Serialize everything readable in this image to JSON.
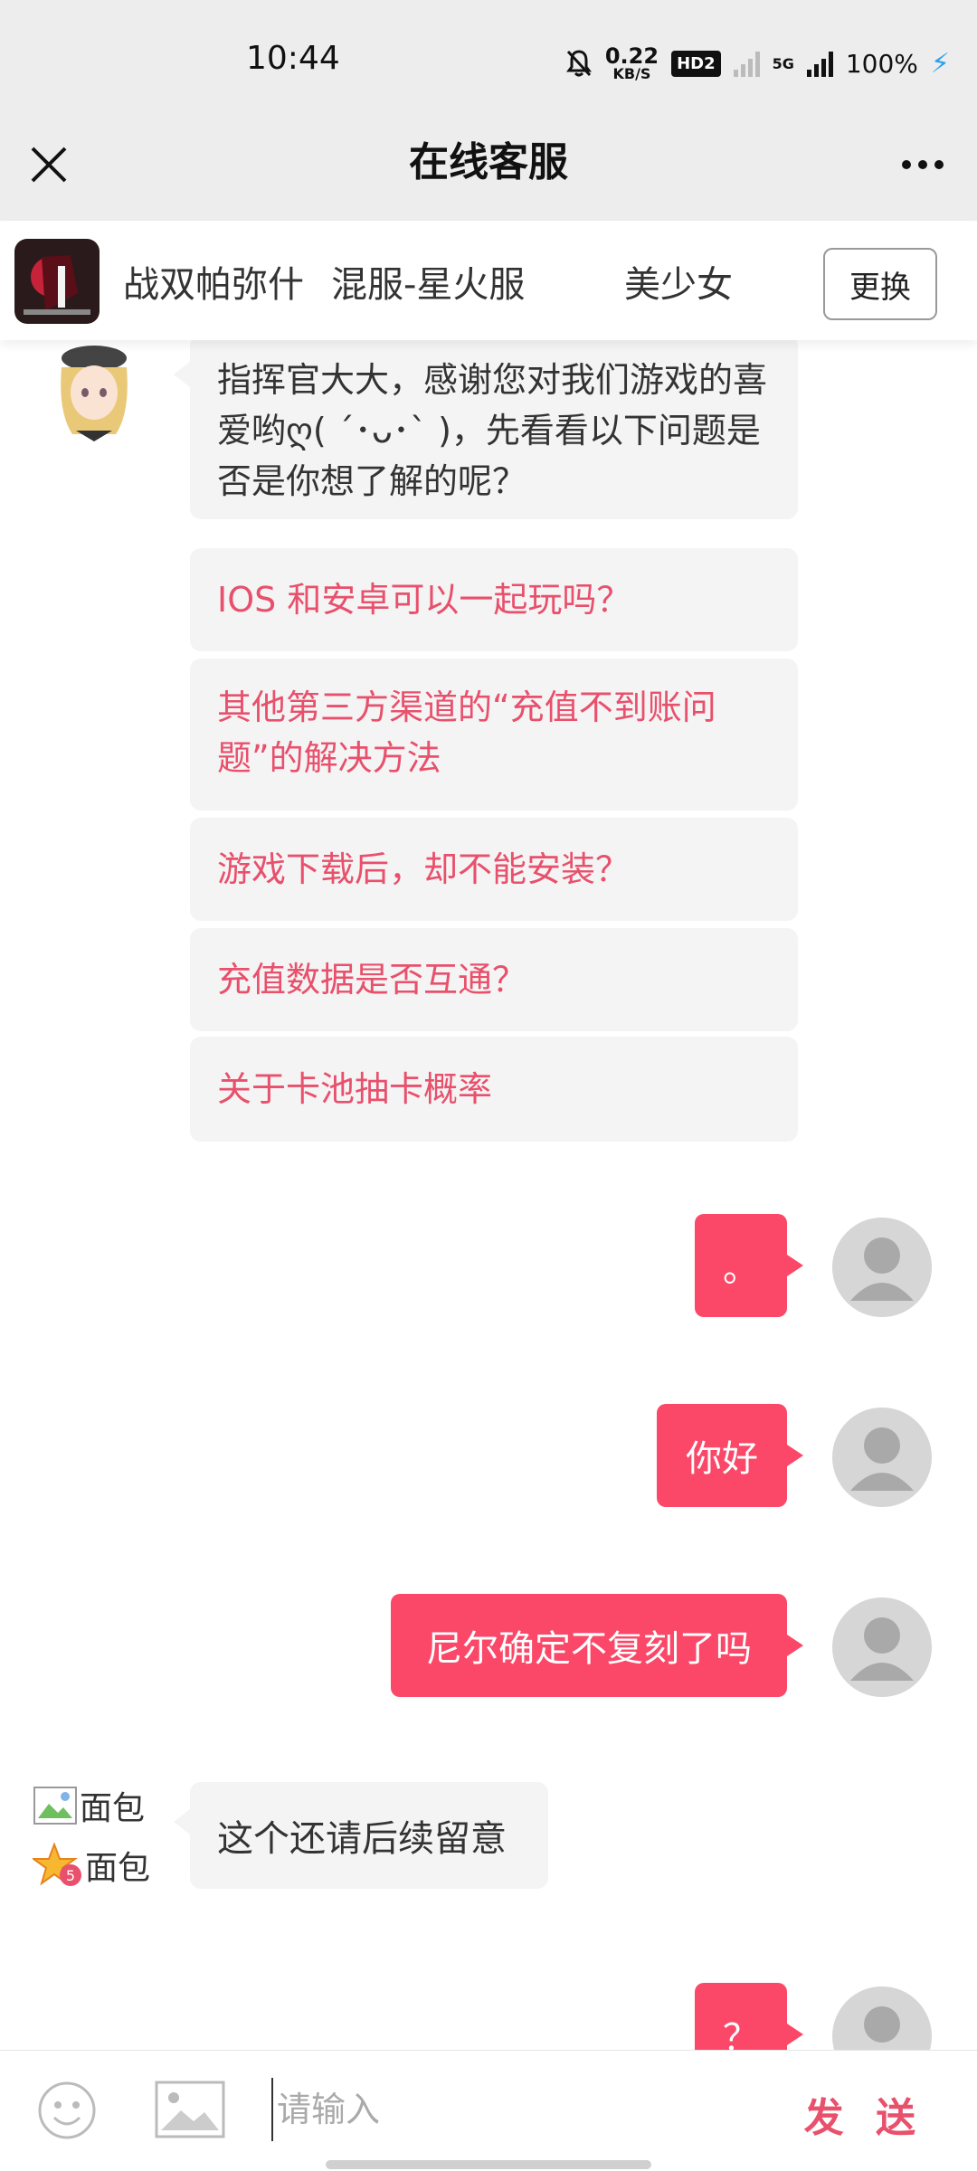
{
  "status_bar": {
    "time": "10:44",
    "net_speed_value": "0.22",
    "net_speed_unit": "KB/S",
    "hd_badge": "HD2",
    "network_type": "5G",
    "battery": "100%",
    "icons": [
      "mute-bell-icon",
      "signal-icon",
      "charging-icon"
    ]
  },
  "header": {
    "title": "在线客服"
  },
  "game_bar": {
    "game_name": "战双帕弥什",
    "server": "混服-星火服",
    "role": "美少女",
    "change_label": "更换"
  },
  "chat": {
    "intro": "指挥官大大，感谢您对我们游戏的喜爱哟ღ( ´･ᴗ･` )，先看看以下问题是否是你想了解的呢？",
    "faq": [
      "IOS 和安卓可以一起玩吗？",
      "其他第三方渠道的“充值不到账问题”的解决方法",
      "游戏下载后，却不能安装？",
      "充值数据是否互通？",
      "关于卡池抽卡概率"
    ],
    "user_messages": [
      "。",
      "你好",
      "尼尔确定不复刻了吗",
      "？"
    ],
    "agent_name": "面包",
    "agent_level_name": "面包",
    "agent_reply": "这个还请后续留意"
  },
  "input_bar": {
    "placeholder": "请输入",
    "send_label": "发 送"
  },
  "colors": {
    "accent": "#fb4868",
    "faq_text": "#e8506c",
    "header_bg": "#ededed",
    "bubble_bg": "#f4f4f4"
  }
}
